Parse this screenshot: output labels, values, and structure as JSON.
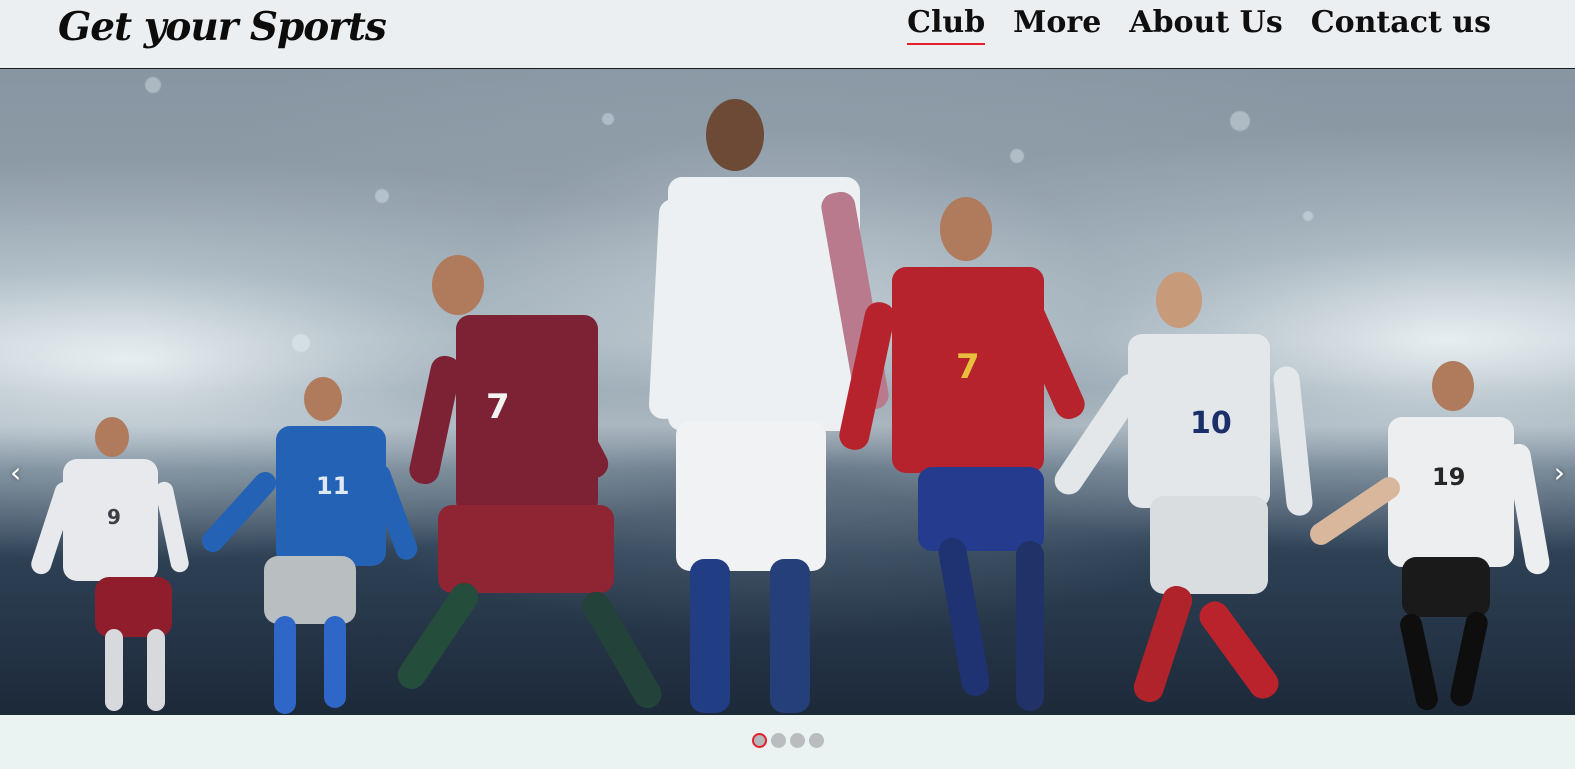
{
  "header": {
    "brand": "Get your Sports",
    "nav": [
      {
        "label": "Club",
        "active": true
      },
      {
        "label": "More",
        "active": false
      },
      {
        "label": "About Us",
        "active": false
      },
      {
        "label": "Contact us",
        "active": false
      }
    ]
  },
  "carousel": {
    "prev_arrow": "‹",
    "next_arrow": "›",
    "slides_count": 4,
    "active_index": 0,
    "players": [
      {
        "number": "9",
        "shirt_color": "#e7e9ec",
        "shorts_color": "#8f1d2c"
      },
      {
        "number": "11",
        "shirt_color": "#2462b5",
        "shorts_color": "#b9bec0"
      },
      {
        "number": "7",
        "shirt_color": "#7d2234",
        "shorts_color": "#8f2432"
      },
      {
        "number": "",
        "shirt_color": "#edf0f2",
        "shorts_color": "#f0f2f4"
      },
      {
        "number": "7",
        "shirt_color": "#b7232c",
        "shorts_color": "#253b8d"
      },
      {
        "number": "10",
        "shirt_color": "#e3e7ea",
        "shorts_color": "#d9dde0"
      },
      {
        "number": "19",
        "shirt_color": "#eceef0",
        "shorts_color": "#1a1a1a"
      }
    ]
  },
  "colors": {
    "accent": "#e3202b",
    "header_bg": "#eceff1",
    "page_bg": "#eaf2f2"
  }
}
